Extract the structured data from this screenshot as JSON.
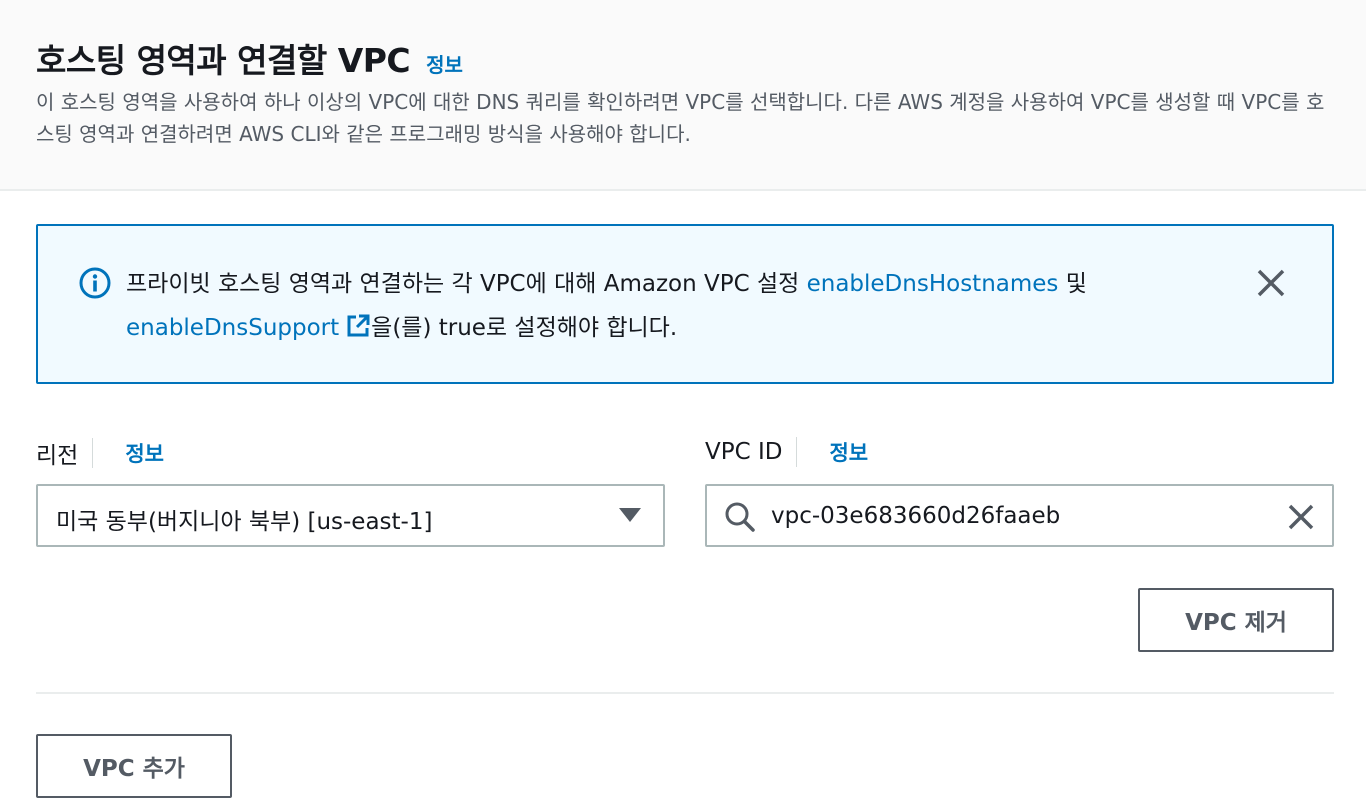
{
  "header": {
    "title": "호스팅 영역과 연결할 VPC",
    "info_link": "정보",
    "description": "이 호스팅 영역을 사용하여 하나 이상의 VPC에 대한 DNS 쿼리를 확인하려면 VPC를 선택합니다. 다른 AWS 계정을 사용하여 VPC를 생성할 때 VPC를 호스팅 영역과 연결하려면 AWS CLI와 같은 프로그래밍 방식을 사용해야 합니다."
  },
  "alert": {
    "icon": "info-circle-icon",
    "text_before": "프라이빗 호스팅 영역과 연결하는 각 VPC에 대해 Amazon VPC 설정 ",
    "link1": "enableDnsHostnames",
    "text_middle": " 및 ",
    "link2": "enableDnsSupport",
    "text_after": "을(를) true로 설정해야 합니다.",
    "accent_color": "#0073bb",
    "background_color": "#f1faff"
  },
  "region": {
    "label": "리전",
    "info_link": "정보",
    "selected": "미국 동부(버지니아 북부) [us-east-1]"
  },
  "vpc": {
    "label": "VPC ID",
    "info_link": "정보",
    "value": "vpc-03e683660d26faaeb"
  },
  "buttons": {
    "remove": "VPC 제거",
    "add": "VPC 추가"
  }
}
